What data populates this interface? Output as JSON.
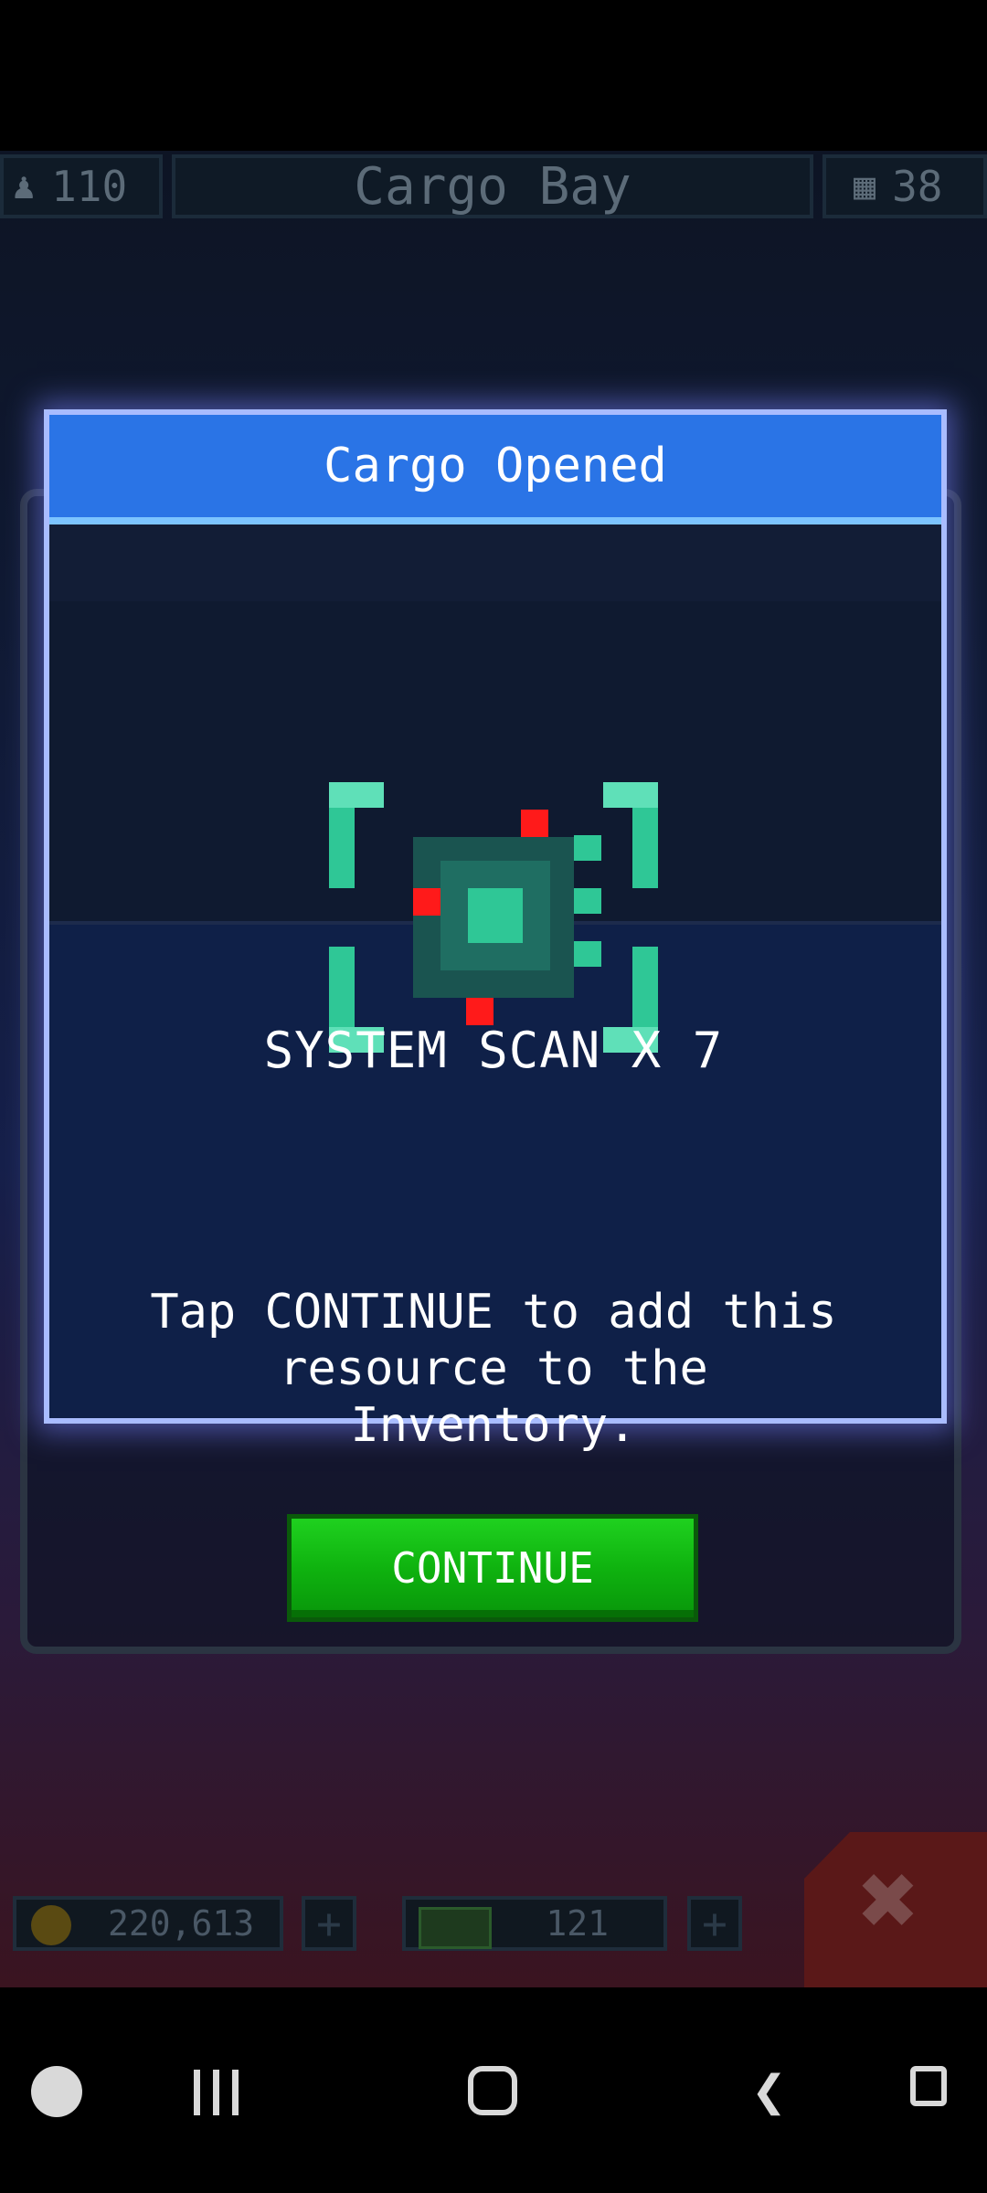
{
  "top_bar": {
    "crew_count": "110",
    "title": "Cargo Bay",
    "cargo_count": "38"
  },
  "dialog": {
    "title": "Cargo Opened",
    "item_name": "SYSTEM SCAN X 7",
    "description": "Tap CONTINUE to add this resource to the Inventory.",
    "continue_label": "CONTINUE"
  },
  "resources": {
    "coins": "220,613",
    "energy": "121"
  },
  "icons": {
    "crew": "person-icon",
    "cargo": "cargo-icon",
    "coin": "coin-icon",
    "energy": "energy-icon",
    "item": "system-scan-chip-icon"
  },
  "colors": {
    "header": "#2a74e6",
    "continue": "#10c010",
    "chip": "#2fd1a0",
    "chip_dots": "#ff1a1a"
  }
}
